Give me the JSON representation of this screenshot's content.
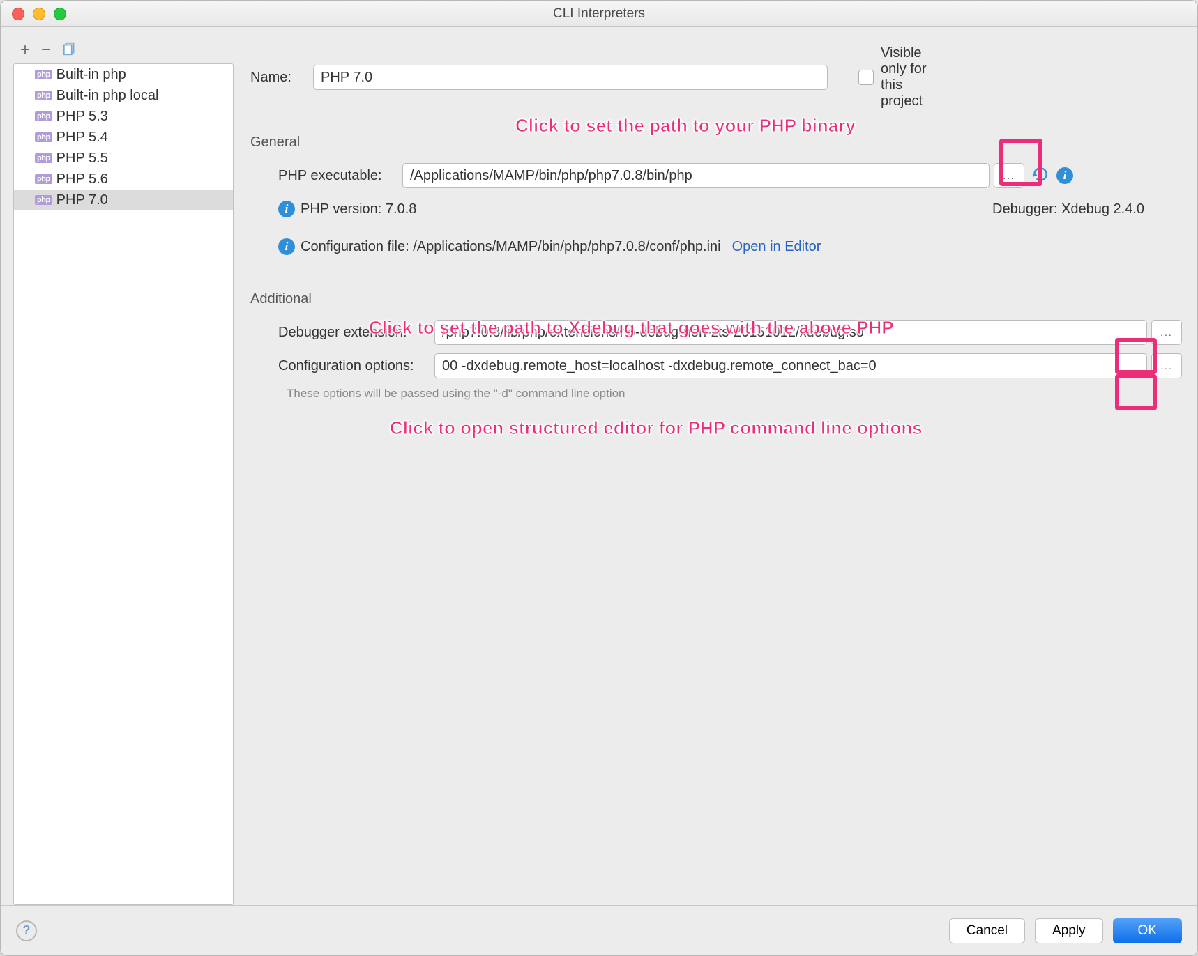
{
  "window": {
    "title": "CLI Interpreters"
  },
  "sidebar": {
    "items": [
      {
        "label": "Built-in php"
      },
      {
        "label": "Built-in php local"
      },
      {
        "label": "PHP 5.3"
      },
      {
        "label": "PHP 5.4"
      },
      {
        "label": "PHP 5.5"
      },
      {
        "label": "PHP 5.6"
      },
      {
        "label": "PHP 7.0"
      }
    ]
  },
  "form": {
    "name_label": "Name:",
    "name_value": "PHP 7.0",
    "visible_label": "Visible only for this project",
    "section_general": "General",
    "exe_label": "PHP executable:",
    "exe_value": "/Applications/MAMP/bin/php/php7.0.8/bin/php",
    "version_line": "PHP version: 7.0.8",
    "debugger_line": "Debugger: Xdebug 2.4.0",
    "config_line": "Configuration file: /Applications/MAMP/bin/php/php7.0.8/conf/php.ini",
    "open_editor": "Open in Editor",
    "section_additional": "Additional",
    "debugger_ext_label": "Debugger extension:",
    "debugger_ext_value": "/php7.0.8/lib/php/extensions/no-debug-non-zts-20151012/xdebug.so",
    "config_opts_label": "Configuration options:",
    "config_opts_value": "00 -dxdebug.remote_host=localhost -dxdebug.remote_connect_bac=0",
    "hint": "These options will be passed using the \"-d\" command line option"
  },
  "annotations": {
    "a1": "Click to set the path to your PHP binary",
    "a2": "Click to set the path to Xdebug that goes with the above PHP",
    "a3": "Click to open structured editor for PHP command line options"
  },
  "footer": {
    "cancel": "Cancel",
    "apply": "Apply",
    "ok": "OK"
  }
}
